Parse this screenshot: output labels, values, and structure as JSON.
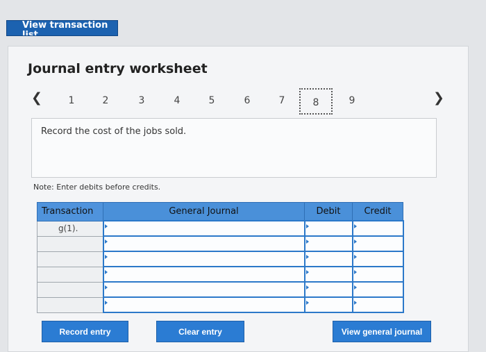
{
  "top_button": {
    "label": "View transaction list"
  },
  "worksheet": {
    "title": "Journal entry worksheet",
    "prev_icon": "chevron-left-icon",
    "next_icon": "chevron-right-icon",
    "pages": [
      "1",
      "2",
      "3",
      "4",
      "5",
      "6",
      "7",
      "8",
      "9"
    ],
    "active_page": "8",
    "prompt": "Record the cost of the jobs sold.",
    "note": "Note: Enter debits before credits."
  },
  "table": {
    "headers": {
      "transaction": "Transaction",
      "general_journal": "General Journal",
      "debit": "Debit",
      "credit": "Credit"
    },
    "rows": [
      {
        "transaction": "g(1)."
      },
      {
        "transaction": ""
      },
      {
        "transaction": ""
      },
      {
        "transaction": ""
      },
      {
        "transaction": ""
      },
      {
        "transaction": ""
      }
    ]
  },
  "buttons": {
    "record": "Record entry",
    "clear": "Clear entry",
    "view_journal": "View general journal"
  },
  "colors": {
    "accent": "#2b7cd3",
    "header": "#4a90d9",
    "input_border": "#2b78c9"
  }
}
